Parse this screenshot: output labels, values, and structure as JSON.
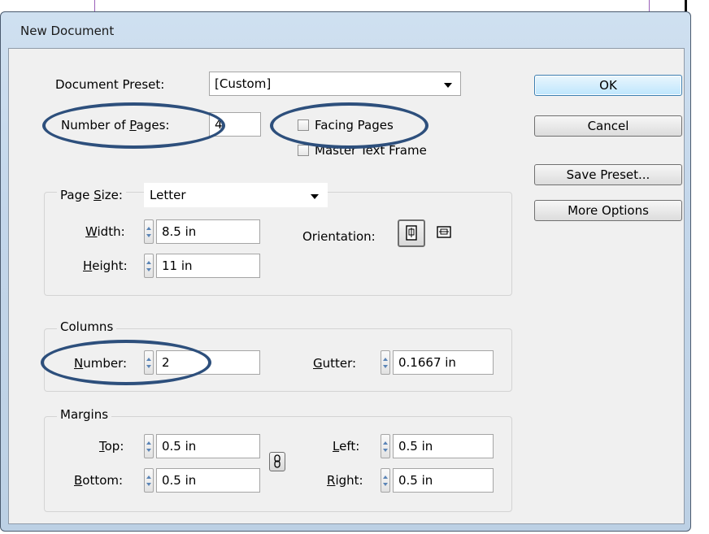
{
  "window": {
    "title": "New Document"
  },
  "document_preset": {
    "label": "Document Preset:",
    "value": "[Custom]"
  },
  "number_of_pages": {
    "label_pre": "Number of ",
    "label_mnemonic": "P",
    "label_post": "ages:",
    "value": "4"
  },
  "facing_pages": {
    "label": "Facing Pages",
    "checked": false
  },
  "master_text_frame": {
    "label": "Master Text Frame",
    "checked": false
  },
  "page_size": {
    "label_pre": "Page ",
    "label_mnemonic": "S",
    "label_post": "ize:",
    "value": "Letter",
    "width": {
      "label_mnemonic": "W",
      "label_post": "idth:",
      "value": "8.5 in"
    },
    "height": {
      "label_mnemonic": "H",
      "label_post": "eight:",
      "value": "11 in"
    },
    "orientation_label": "Orientation:"
  },
  "columns": {
    "legend": "Columns",
    "number": {
      "label_mnemonic": "N",
      "label_post": "umber:",
      "value": "2"
    },
    "gutter": {
      "label_mnemonic": "G",
      "label_post": "utter:",
      "value": "0.1667 in"
    }
  },
  "margins": {
    "legend": "Margins",
    "top": {
      "label_mnemonic": "T",
      "label_post": "op:",
      "value": "0.5 in"
    },
    "bottom": {
      "label_mnemonic": "B",
      "label_post": "ottom:",
      "value": "0.5 in"
    },
    "left": {
      "label_mnemonic": "L",
      "label_post": "eft:",
      "value": "0.5 in"
    },
    "right": {
      "label_mnemonic": "R",
      "label_post": "ight:",
      "value": "0.5 in"
    }
  },
  "buttons": {
    "ok": "OK",
    "cancel": "Cancel",
    "save_preset": "Save Preset...",
    "more_options": "More Options"
  },
  "colors": {
    "highlight_oval": "#2d4f7c",
    "default_button_border": "#3c7fb1"
  }
}
